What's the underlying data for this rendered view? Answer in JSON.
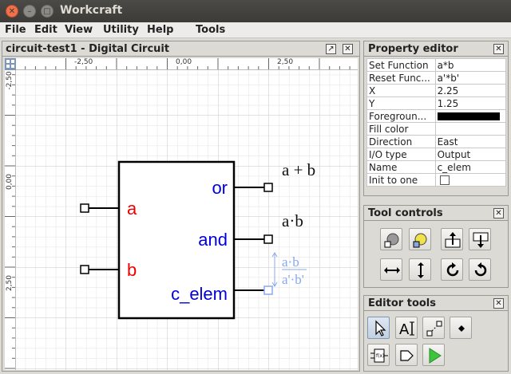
{
  "window": {
    "title": "Workcraft"
  },
  "menu": [
    {
      "label": "File"
    },
    {
      "label": "Edit"
    },
    {
      "label": "View"
    },
    {
      "label": "Utility"
    },
    {
      "label": "Help"
    },
    {
      "label": "Tools"
    }
  ],
  "editor": {
    "title": "circuit-test1 - Digital Circuit",
    "ruler_top": [
      "-2,50",
      "0,00",
      "2,50"
    ],
    "ruler_left": [
      "-2,50",
      "0,00",
      "2,50"
    ],
    "component": {
      "inputs": [
        "a",
        "b"
      ],
      "outputs": [
        "or",
        "and",
        "c_elem"
      ],
      "labels": [
        "a + b",
        "a·b"
      ],
      "set_expr": "a·b",
      "reset_expr": "a'·b'"
    }
  },
  "property_editor": {
    "title": "Property editor",
    "rows": [
      {
        "key": "Set Function",
        "value": "a*b"
      },
      {
        "key": "Reset Func...",
        "value": "a'*b'"
      },
      {
        "key": "X",
        "value": "2.25"
      },
      {
        "key": "Y",
        "value": "1.25"
      },
      {
        "key": "Foregroun...",
        "value": ""
      },
      {
        "key": "Fill color",
        "value": ""
      },
      {
        "key": "Direction",
        "value": "East"
      },
      {
        "key": "I/O type",
        "value": "Output"
      },
      {
        "key": "Name",
        "value": "c_elem"
      },
      {
        "key": "Init to one",
        "value": ""
      }
    ],
    "foreground_color": "#000000"
  },
  "tool_controls": {
    "title": "Tool controls",
    "buttons": [
      "set-input-icon",
      "set-output-icon",
      "move-up-icon",
      "move-down-icon",
      "flip-horizontal-icon",
      "flip-vertical-icon",
      "rotate-clockwise-icon",
      "rotate-counterclockwise-icon"
    ]
  },
  "editor_tools": {
    "title": "Editor tools",
    "buttons": [
      "select-tool-icon",
      "text-tool-icon",
      "connect-tool-icon",
      "contact-tool-icon",
      "function-component-icon",
      "gate-tool-icon",
      "simulation-icon"
    ]
  },
  "colors": {
    "input_label": "#ee0000",
    "output_label": "#0000dd",
    "selected_contact": "#88aaee"
  }
}
